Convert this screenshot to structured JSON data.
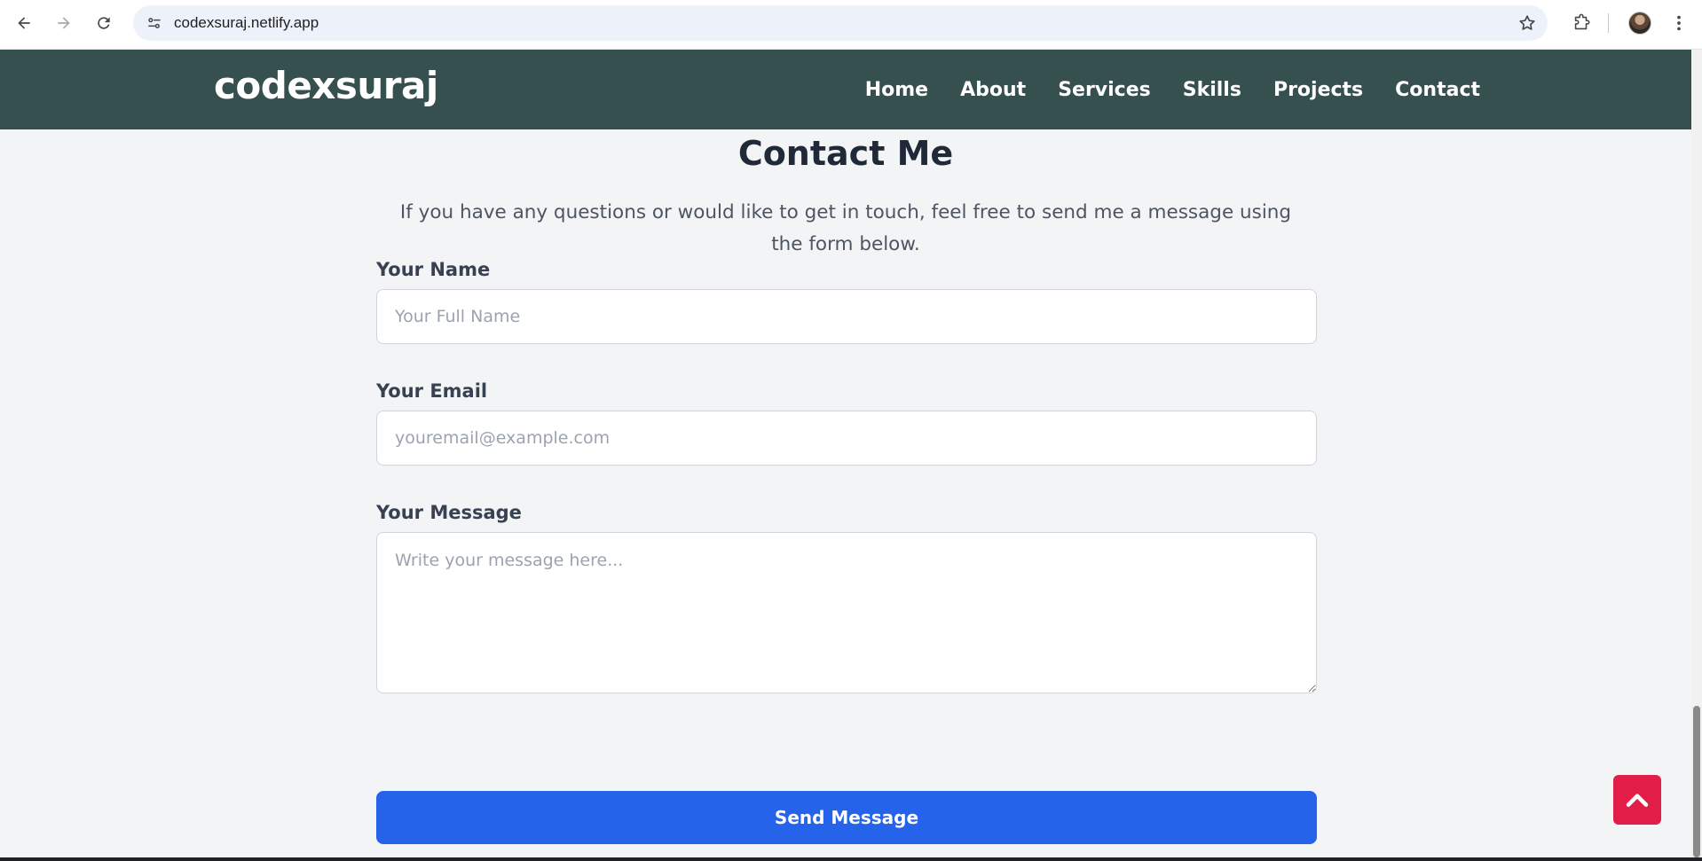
{
  "browser": {
    "url": "codexsuraj.netlify.app",
    "icons": [
      "back-icon",
      "forward-icon",
      "reload-icon",
      "site-info-icon",
      "bookmark-star-icon",
      "extensions-icon",
      "profile-avatar",
      "more-menu-icon"
    ]
  },
  "header": {
    "brand": "codexsuraj",
    "nav": [
      "Home",
      "About",
      "Services",
      "Skills",
      "Projects",
      "Contact"
    ]
  },
  "contact": {
    "title": "Contact Me",
    "subtitle": "If you have any questions or would like to get in touch, feel free to send me a message using the form below.",
    "name_label": "Your Name",
    "name_placeholder": "Your Full Name",
    "email_label": "Your Email",
    "email_placeholder": "youremail@example.com",
    "message_label": "Your Message",
    "message_placeholder": "Write your message here...",
    "submit_label": "Send Message"
  },
  "colors": {
    "header_bg": "#364f4f",
    "page_bg": "#f3f4f6",
    "button_bg": "#2563eb",
    "back_to_top_bg": "#e11d48"
  }
}
